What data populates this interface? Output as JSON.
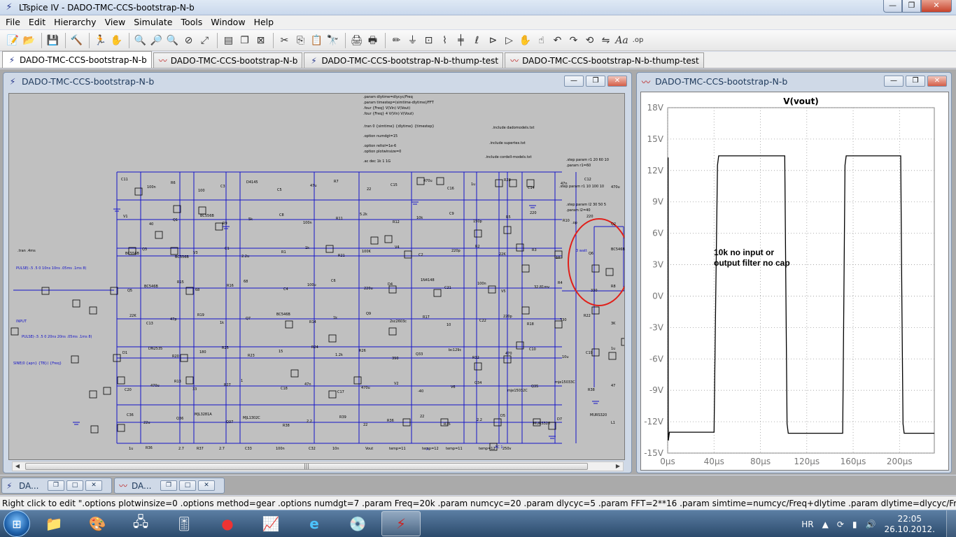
{
  "app": {
    "title": "LTspice IV - DADO-TMC-CCS-bootstrap-N-b",
    "window_buttons": [
      "—",
      "❐",
      "✕"
    ]
  },
  "menu": [
    "File",
    "Edit",
    "Hierarchy",
    "View",
    "Simulate",
    "Tools",
    "Window",
    "Help"
  ],
  "toolbar_icons": [
    "new-schematic-icon",
    "open-icon",
    "save-icon",
    "control-panel-icon",
    "run-icon",
    "halt-icon",
    "zoom-in-icon",
    "zoom-pan-icon",
    "zoom-out-icon",
    "zoom-cancel-icon",
    "autoscale-icon",
    "tile-icon",
    "cascade-icon",
    "close-all-icon",
    "cut-icon",
    "copy-icon",
    "paste-icon",
    "find-icon",
    "print-icon",
    "print-preview-icon",
    "draw-wire-icon",
    "ground-icon",
    "label-net-icon",
    "resistor-icon",
    "capacitor-icon",
    "inductor-icon",
    "diode-icon",
    "component-icon",
    "move-icon",
    "drag-icon",
    "undo-icon",
    "redo-icon",
    "rotate-icon",
    "mirror-icon",
    "text-icon",
    "spice-directive-icon"
  ],
  "tabs": [
    {
      "label": "DADO-TMC-CCS-bootstrap-N-b",
      "kind": "schematic",
      "active": true
    },
    {
      "label": "DADO-TMC-CCS-bootstrap-N-b",
      "kind": "waveform",
      "active": false
    },
    {
      "label": "DADO-TMC-CCS-bootstrap-N-b-thump-test",
      "kind": "schematic",
      "active": false
    },
    {
      "label": "DADO-TMC-CCS-bootstrap-N-b-thump-test",
      "kind": "waveform",
      "active": false
    }
  ],
  "schematic_window": {
    "title": "DADO-TMC-CCS-bootstrap-N-b",
    "directives": [
      ".param dlytime=dlycyc/Freq",
      ".param timestep=(simtime-dlytime)/FFT",
      ".four {Freq} V(Vin) V(Vout)",
      ".four {Freq} 4 V(Vin) V(Vout)",
      ".tran 0 {simtime} {dlytime} {timestep}",
      ".option numdgt=15",
      ".option reltol=1e-6",
      ".option plotwinsize=0",
      ".ac dec 1k 1 1G",
      ".include dadomodels.txt",
      ".include supertex.txt",
      ".include cordell-models.txt",
      ".step param r1 20 60 10",
      ".param r1=60",
      ".step param r1 10 100 10",
      ".step param l2 30 50 5",
      ".param l2=40",
      ".op",
      ".tran .4ms",
      "PULSE(-.5 .5 0 10ns 10ns .05ms .1ms 8)",
      "PULSE(-.5 .5 0 20ns 20ns .05ms .1ms 8)",
      "SINE(0 {apn} {TB}) {Freq}",
      "INPUT",
      "3 watt",
      "AC 1",
      "A"
    ],
    "parts": [
      "C11",
      "100n",
      "R6",
      "100",
      "C3",
      "D4145",
      "C5",
      "47u",
      "R7",
      "22",
      "C15",
      "470u",
      "C16",
      "1u",
      "R28",
      "C14",
      "47n",
      "C12",
      "470u",
      "V1",
      "40",
      "Q1",
      "BC556B",
      "R9",
      "5k",
      "C8",
      "100n",
      "R11",
      "5.2k",
      "R12",
      "10k",
      "C9",
      "150p",
      "R5",
      "220",
      "R10",
      "220",
      "Q2",
      "BC556B",
      "Q3",
      "BC556B",
      "V3",
      "C1",
      "2.2u",
      "R1",
      "1k",
      "R21",
      "100K",
      "V4",
      "C2",
      "220p",
      "R2",
      "22K",
      "R3",
      "10",
      "Q6",
      "BC546B",
      "Q5",
      "BC546B",
      "R15",
      "68",
      "R16",
      "68",
      "C4",
      "100u",
      "C6",
      "220u",
      "D4",
      "1N4148",
      "C21",
      "100n",
      "V5",
      "32.81mv",
      "R4",
      "330",
      "R8",
      "22K",
      "C13",
      "47p",
      "R19",
      "1k",
      "Q7",
      "BC546B",
      "R14",
      "1k",
      "Q9",
      "2sc2603c",
      "R17",
      "10",
      "C22",
      "220p",
      "R18",
      "330",
      "R22",
      "3K",
      "D1",
      "DN2535",
      "R20",
      "180",
      "R25",
      "R23",
      "15",
      "R24",
      "1.2k",
      "R26",
      "390",
      "Q33",
      "bc129c",
      "R32",
      "470",
      "C10",
      "10u",
      "C19",
      "1u",
      "C20",
      "470u",
      "R13",
      "33",
      "R27",
      "1",
      "C18",
      "47n",
      "C17",
      "470u",
      "V2",
      "-40",
      "V6",
      "Q34",
      "mje15032C",
      "Q35",
      "mje15033C",
      "R38",
      "47",
      "C36",
      "22u",
      "Q36",
      "MJL3281A",
      "Q37",
      "MJL1302C",
      "R38",
      "2.2",
      "R39",
      "22",
      "R36",
      "22",
      "R35",
      "2.2",
      "D5",
      "MURS320",
      "D7",
      "MURS320",
      "L1",
      "1u",
      "R36",
      "2.7",
      "R37",
      "2.7",
      "C33",
      "100n",
      "C32",
      "10n",
      "Vout",
      "temp=11",
      "temp=12",
      "temp=11",
      "temp=12",
      "250v"
    ]
  },
  "waveform_window": {
    "title": "DADO-TMC-CCS-bootstrap-N-b",
    "trace_label": "V(vout)",
    "annotation_line1": "10k no input or",
    "annotation_line2": "output filter no cap"
  },
  "chart_data": {
    "type": "line",
    "series": [
      {
        "name": "V(vout)",
        "color": "#000000",
        "x": [
          0,
          0.2,
          0.4,
          0.5,
          0.6,
          1.5,
          2,
          5,
          10,
          20,
          30,
          40,
          41.5,
          43,
          44,
          50,
          60,
          70,
          80,
          90,
          100,
          101,
          102,
          103,
          104,
          110,
          120,
          130,
          140,
          150,
          151,
          152,
          153,
          154,
          160,
          170,
          180,
          190,
          200,
          201,
          202,
          203,
          204,
          210,
          220,
          230
        ],
        "y": [
          13.2,
          13.2,
          13.2,
          -11.8,
          -13.8,
          -13.0,
          -13.0,
          -13.0,
          -13.0,
          -13.0,
          -13.0,
          -13.0,
          0,
          12.5,
          13.4,
          13.4,
          13.4,
          13.4,
          13.4,
          13.4,
          13.4,
          13.4,
          0,
          -12.2,
          -13.1,
          -13.1,
          -13.1,
          -13.1,
          -13.1,
          -13.1,
          -13.1,
          0,
          12.5,
          13.4,
          13.4,
          13.4,
          13.4,
          13.4,
          13.4,
          13.4,
          0,
          -12.2,
          -13.1,
          -13.1,
          -13.1,
          -13.1
        ]
      }
    ],
    "title": "",
    "xlabel": "",
    "ylabel": "",
    "xlim": [
      0,
      230
    ],
    "ylim": [
      -15,
      18
    ],
    "x_ticks": [
      "0µs",
      "40µs",
      "80µs",
      "120µs",
      "160µs",
      "200µs"
    ],
    "x_tick_values": [
      0,
      40,
      80,
      120,
      160,
      200
    ],
    "y_ticks": [
      "18V",
      "15V",
      "12V",
      "9V",
      "6V",
      "3V",
      "0V",
      "-3V",
      "-6V",
      "-9V",
      "-12V",
      "-15V"
    ],
    "y_tick_values": [
      18,
      15,
      12,
      9,
      6,
      3,
      0,
      -3,
      -6,
      -9,
      -12,
      -15
    ],
    "grid": true,
    "legend": "top-center"
  },
  "minimized_windows": [
    {
      "label": "DA...",
      "kind": "schematic"
    },
    {
      "label": "DA...",
      "kind": "waveform"
    }
  ],
  "status_bar": "Right click to edit \".options plotwinsize=0  .options method=gear  .options numdgt=7  .param Freq=20k  .param numcyc=20  .param dlycyc=5  .param FFT=2**16  .param simtime=numcyc/Freq+dlytime  .param dlytime=dlycyc/Freq  .param timeste",
  "taskbar": {
    "start": "windows-start-icon",
    "apps": [
      "explorer-icon",
      "paint-icon",
      "network-icon",
      "mixer-icon",
      "red-app-icon",
      "oscilloscope-icon",
      "internet-explorer-icon",
      "media-player-icon",
      "ltspice-icon"
    ],
    "language": "HR",
    "time": "22:05",
    "date": "26.10.2012."
  }
}
